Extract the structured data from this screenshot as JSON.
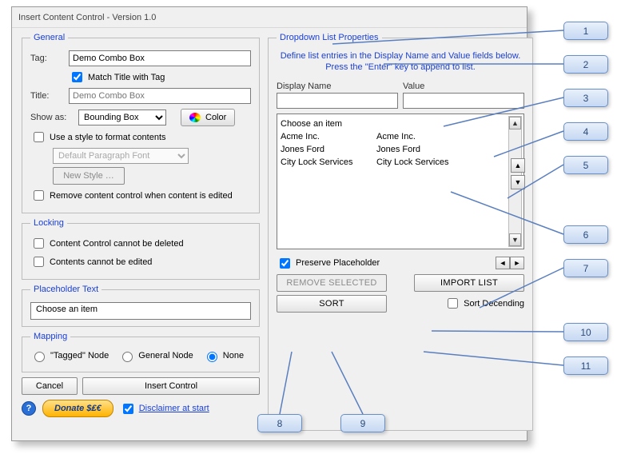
{
  "window": {
    "title": "Insert Content Control - Version 1.0"
  },
  "general": {
    "legend": "General",
    "tag_label": "Tag:",
    "tag_value": "Demo Combo Box",
    "match_title_label": "Match Title with Tag",
    "match_title_checked": true,
    "title_label": "Title:",
    "title_placeholder": "Demo Combo Box",
    "showas_label": "Show as:",
    "showas_value": "Bounding Box",
    "color_label": "Color",
    "usestyle_label": "Use a style to format contents",
    "style_value": "Default Paragraph Font",
    "newstyle_label": "New Style …",
    "remove_on_edit_label": "Remove content control when content is edited"
  },
  "locking": {
    "legend": "Locking",
    "cannot_delete_label": "Content Control cannot be deleted",
    "cannot_edit_label": "Contents cannot be edited"
  },
  "placeholder": {
    "legend": "Placeholder Text",
    "value": "Choose an item"
  },
  "mapping": {
    "legend": "Mapping",
    "opt_tagged": "\"Tagged\" Node",
    "opt_general": "General Node",
    "opt_none": "None",
    "selected": "none"
  },
  "footer": {
    "cancel": "Cancel",
    "insert": "Insert Control",
    "donate": "Donate $₤€",
    "disclaimer_label": "Disclaimer at start",
    "disclaimer_checked": true
  },
  "dropdown": {
    "legend": "Dropdown List Properties",
    "instructions": "Define list entries in the Display Name and Value fields below. Press the \"Enter\" key to append to list.",
    "displayname_label": "Display Name",
    "value_label": "Value",
    "entries": [
      {
        "display": "Choose an item",
        "value": ""
      },
      {
        "display": "Acme Inc.",
        "value": "Acme Inc."
      },
      {
        "display": "Jones Ford",
        "value": "Jones Ford"
      },
      {
        "display": "City Lock Services",
        "value": "City Lock Services"
      }
    ],
    "preserve_label": "Preserve Placeholder",
    "preserve_checked": true,
    "remove_selected": "REMOVE SELECTED",
    "import_list": "IMPORT LIST",
    "sort": "SORT",
    "sort_desc_label": "Sort Decending"
  },
  "callouts": [
    "1",
    "2",
    "3",
    "4",
    "5",
    "6",
    "7",
    "8",
    "9",
    "10",
    "11"
  ]
}
